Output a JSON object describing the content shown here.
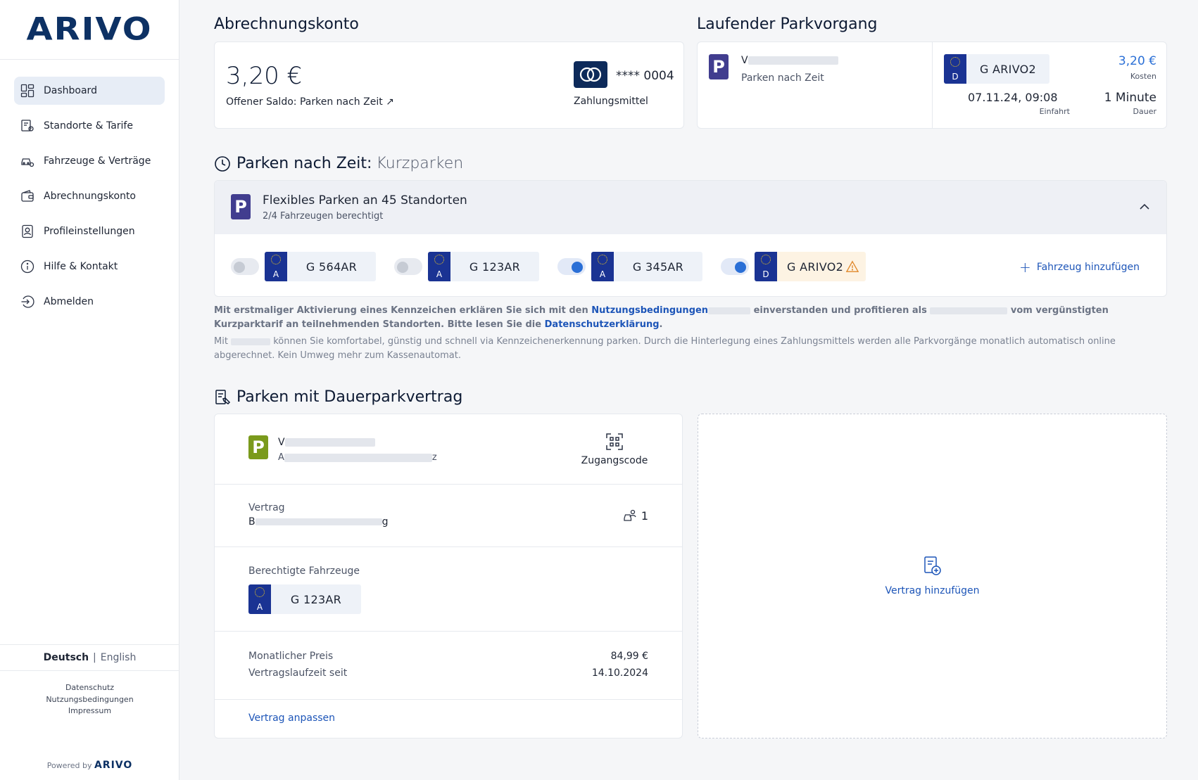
{
  "brand": {
    "logo": "ARIVO",
    "powered_by": "Powered by",
    "powered_logo": "ARIVO"
  },
  "sidebar": {
    "items": [
      {
        "label": "Dashboard",
        "icon": "dashboard-icon",
        "active": true
      },
      {
        "label": "Standorte & Tarife",
        "icon": "location-tariff-icon",
        "active": false
      },
      {
        "label": "Fahrzeuge & Verträge",
        "icon": "car-settings-icon",
        "active": false
      },
      {
        "label": "Abrechnungskonto",
        "icon": "wallet-icon",
        "active": false
      },
      {
        "label": "Profileinstellungen",
        "icon": "profile-icon",
        "active": false
      },
      {
        "label": "Hilfe & Kontakt",
        "icon": "info-icon",
        "active": false
      },
      {
        "label": "Abmelden",
        "icon": "logout-icon",
        "active": false
      }
    ],
    "language": {
      "current": "Deutsch",
      "separator": "|",
      "other": "English"
    },
    "footer_links": [
      "Datenschutz",
      "Nutzungsbedingungen",
      "Impressum"
    ]
  },
  "billing": {
    "heading": "Abrechnungskonto",
    "amount": "3,20 €",
    "subtitle": "Offener Saldo: Parken nach Zeit ↗",
    "card_masked": "**** 0004",
    "card_brand": "mastercard",
    "payment_label": "Zahlungsmittel"
  },
  "current_parking": {
    "heading": "Laufender Parkvorgang",
    "location_initial": "V",
    "type": "Parken nach Zeit",
    "plate_country": "D",
    "plate": "G ARIVO2",
    "cost": "3,20 €",
    "cost_label": "Kosten",
    "entry": "07.11.24, 09:08",
    "entry_label": "Einfahrt",
    "duration": "1 Minute",
    "duration_label": "Dauer"
  },
  "time_parking": {
    "heading_bold": "Parken nach Zeit:",
    "heading_light": "Kurzparken",
    "panel_title": "Flexibles Parken an 45 Standorten",
    "panel_subtitle": "2/4 Fahrzeugen berechtigt",
    "vehicles": [
      {
        "country": "A",
        "plate": "G 564AR",
        "enabled": false,
        "warning": false
      },
      {
        "country": "A",
        "plate": "G 123AR",
        "enabled": false,
        "warning": false
      },
      {
        "country": "A",
        "plate": "G 345AR",
        "enabled": true,
        "warning": false
      },
      {
        "country": "D",
        "plate": "G ARIVO2",
        "enabled": true,
        "warning": true
      }
    ],
    "add_vehicle": "Fahrzeug hinzufügen",
    "notice_1a": "Mit erstmaliger Aktivierung eines Kennzeichen erklären Sie sich mit den",
    "notice_link_1": "Nutzungsbedingungen",
    "notice_1b": "einverstanden und profitieren als",
    "notice_1c": "vom vergünstigten Kurzparktarif an teilnehmenden Standorten. Bitte lesen Sie die",
    "notice_link_2": "Datenschutzerklärung",
    "notice_1d": ".",
    "notice_2a": "Mit",
    "notice_2b": "können Sie komfortabel, günstig und schnell via Kennzeichenerkennung parken. Durch die Hinterlegung eines Zahlungsmittels werden alle Parkvorgänge monatlich automatisch online abgerechnet. Kein Umweg mehr zum Kassenautomat."
  },
  "permanent_parking": {
    "heading": "Parken mit Dauerparkvertrag",
    "location_initial": "V",
    "address_initial": "A",
    "address_tail": "z",
    "access_code_label": "Zugangscode",
    "contract_label": "Vertrag",
    "contract_initial": "B",
    "contract_tail": "g",
    "slots": "1",
    "vehicles_label": "Berechtigte Fahrzeuge",
    "vehicle_country": "A",
    "vehicle_plate": "G 123AR",
    "monthly_price_label": "Monatlicher Preis",
    "monthly_price": "84,99 €",
    "term_label": "Vertragslaufzeit seit",
    "term_since": "14.10.2024",
    "adjust_link": "Vertrag anpassen",
    "add_contract": "Vertrag hinzufügen"
  },
  "colors": {
    "brand_navy": "#0d3164",
    "accent_blue": "#1d55b8",
    "parking_purple": "#413d8f",
    "parking_green": "#7a9a1c",
    "warning_orange": "#e0882a",
    "eu_blue": "#1a3393"
  }
}
